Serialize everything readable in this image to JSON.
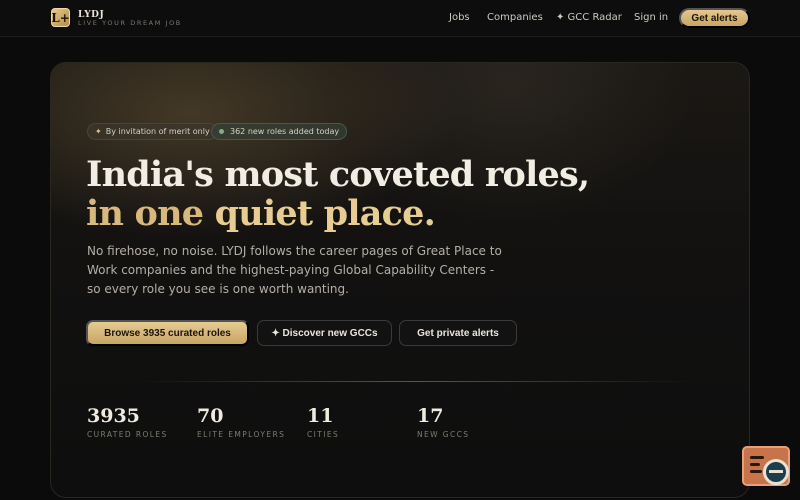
{
  "header": {
    "logo_glyph": "L+",
    "brand_name": "LYDJ",
    "brand_tagline": "LIVE YOUR DREAM JOB",
    "nav": {
      "jobs": "Jobs",
      "companies": "Companies",
      "gcc_radar": "✦ GCC Radar",
      "sign_in": "Sign in"
    },
    "cta": "Get alerts"
  },
  "hero": {
    "badges": {
      "invite": "By invitation of merit only",
      "new_roles": "362 new roles added today"
    },
    "headline_line1": "India's most coveted roles,",
    "headline_line2a": "in one ",
    "headline_line2b": "quiet place.",
    "subtext": "No firehose, no noise. LYDJ follows the career pages of Great Place to Work companies and the highest-paying Global Capability Centers - so every role you see is one worth wanting.",
    "buttons": {
      "browse": "Browse 3935 curated roles",
      "gcc": "✦ Discover new GCCs",
      "alerts": "Get private alerts"
    },
    "stats": [
      {
        "value": "3935",
        "label": "CURATED ROLES"
      },
      {
        "value": "70",
        "label": "ELITE EMPLOYERS"
      },
      {
        "value": "11",
        "label": "CITIES"
      },
      {
        "value": "17",
        "label": "NEW GCCS"
      }
    ]
  },
  "colors": {
    "accent_gold": "#d9b97b",
    "background": "#0b0b0b",
    "widget": "#c8744a"
  },
  "icons": {
    "badge_invite": "sparkle-icon",
    "badge_new": "status-dot-icon",
    "widget": "search-widget-icon"
  }
}
